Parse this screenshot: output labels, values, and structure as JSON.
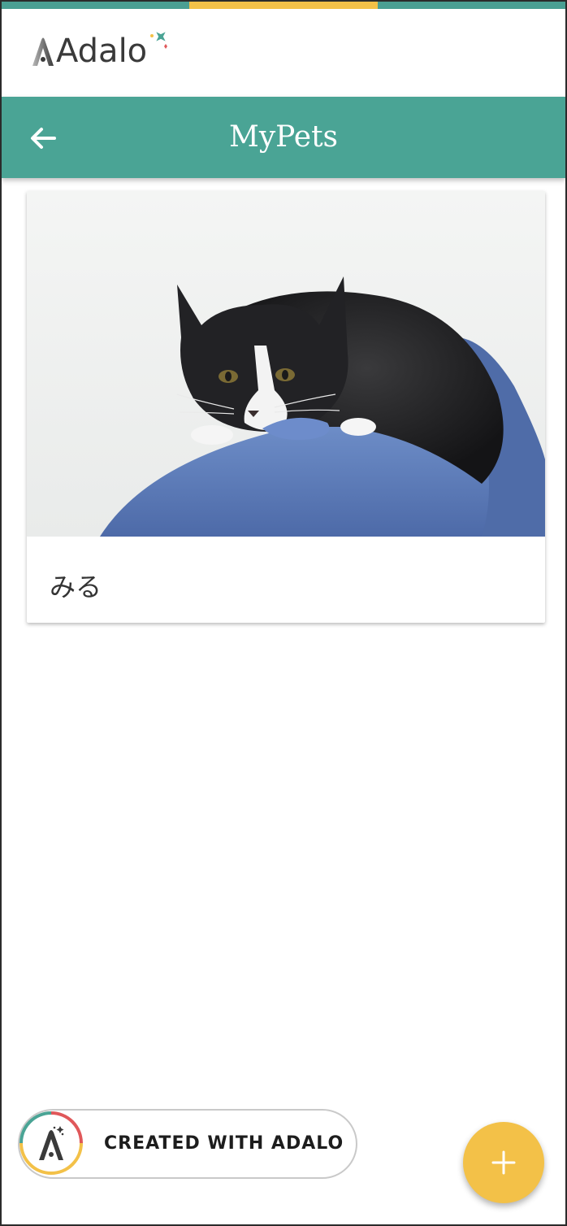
{
  "brand": {
    "logo_text": "Adalo"
  },
  "header": {
    "title": "MyPets",
    "back_icon": "arrow-left-icon"
  },
  "pets": [
    {
      "name": "みる",
      "photo": "black-and-white-cat-on-blue-sofa"
    }
  ],
  "badge": {
    "label": "CREATED WITH ADALO"
  },
  "fab": {
    "icon": "plus-icon"
  },
  "colors": {
    "primary": "#4aa495",
    "accent": "#f3c148",
    "strip_teal": "#4a9f93",
    "strip_yellow": "#f3c148",
    "text_dark": "#333333"
  }
}
